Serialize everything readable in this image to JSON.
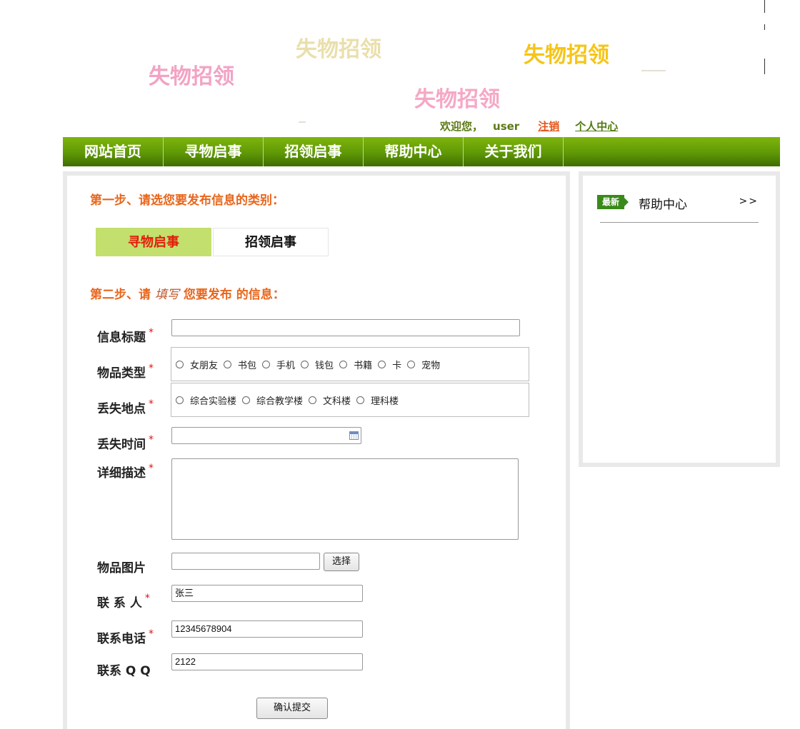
{
  "banner": {
    "words": [
      {
        "text": "失物招领",
        "color": "#f2a3c4"
      },
      {
        "text": "失物招领",
        "color": "#eadfab"
      },
      {
        "text": "失物招领",
        "color": "#f5c518"
      },
      {
        "text": "失物招领",
        "color": "#f5a8c4"
      }
    ]
  },
  "user_bar": {
    "welcome": "欢迎您，",
    "username": "user",
    "logout": "注销",
    "personal_center": "个人中心"
  },
  "nav": {
    "items": [
      {
        "label": "网站首页"
      },
      {
        "label": "寻物启事"
      },
      {
        "label": "招领启事"
      },
      {
        "label": "帮助中心"
      },
      {
        "label": "关于我们"
      }
    ]
  },
  "form": {
    "step1": "第一步、请选您要发布信息的类别：",
    "category_tabs": [
      {
        "label": "寻物启事",
        "active": true
      },
      {
        "label": "招领启事",
        "active": false
      }
    ],
    "step2_prefix": "第二步、请",
    "step2_cursive": "填写",
    "step2_suffix": "您要发布 的信息：",
    "required_mark": "*",
    "fields": {
      "title": {
        "label": "信息标题",
        "value": ""
      },
      "item_type": {
        "label": "物品类型",
        "options": [
          "女朋友",
          "书包",
          "手机",
          "钱包",
          "书籍",
          "卡",
          "宠物"
        ]
      },
      "lost_place": {
        "label": "丢失地点",
        "options": [
          "综合实验楼",
          "综合教学楼",
          "文科楼",
          "理科楼"
        ]
      },
      "lost_time": {
        "label": "丢失时间",
        "value": ""
      },
      "description": {
        "label": "详细描述",
        "value": ""
      },
      "image": {
        "label": "物品图片",
        "value": "",
        "button": "选择"
      },
      "contact": {
        "label": "联 系 人",
        "value": "张三"
      },
      "phone": {
        "label": "联系电话",
        "value": "12345678904"
      },
      "qq": {
        "label": "联系 Q Q",
        "value": "2122"
      }
    },
    "submit": "确认提交"
  },
  "side": {
    "badge": "最新",
    "title": "帮助中心",
    "more": ">>"
  },
  "colors": {
    "nav_green": "#5f9806",
    "step_orange": "#e8661c",
    "tab_active_bg": "#c3df6d",
    "tab_active_text": "#e21c0c",
    "required_red": "#e01010"
  }
}
